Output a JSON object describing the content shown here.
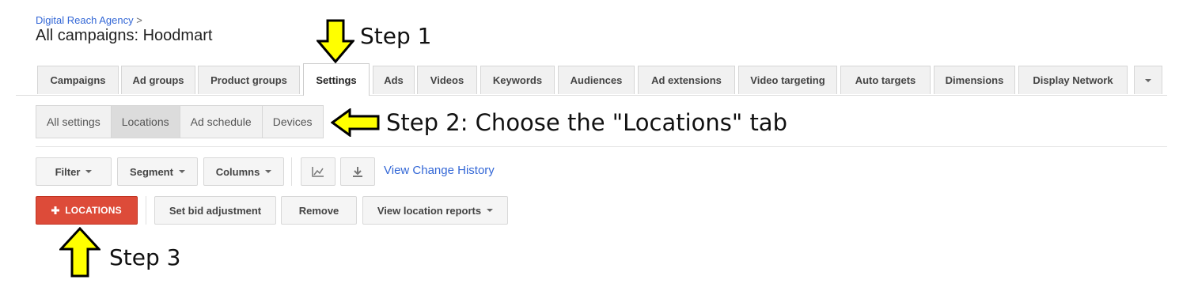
{
  "breadcrumb": {
    "parent": "Digital Reach Agency",
    "separator": ">"
  },
  "page_title": "All campaigns: Hoodmart",
  "main_tabs": [
    {
      "label": "Campaigns"
    },
    {
      "label": "Ad groups"
    },
    {
      "label": "Product groups"
    },
    {
      "label": "Settings"
    },
    {
      "label": "Ads"
    },
    {
      "label": "Videos"
    },
    {
      "label": "Keywords"
    },
    {
      "label": "Audiences"
    },
    {
      "label": "Ad extensions"
    },
    {
      "label": "Video targeting"
    },
    {
      "label": "Auto targets"
    },
    {
      "label": "Dimensions"
    },
    {
      "label": "Display Network"
    }
  ],
  "active_main_tab": "Settings",
  "sub_tabs": [
    {
      "label": "All settings"
    },
    {
      "label": "Locations"
    },
    {
      "label": "Ad schedule"
    },
    {
      "label": "Devices"
    }
  ],
  "active_sub_tab": "Locations",
  "toolbar": {
    "filter_label": "Filter",
    "segment_label": "Segment",
    "columns_label": "Columns",
    "chart_icon": "chart-line-icon",
    "download_icon": "download-icon",
    "change_history_link": "View Change History"
  },
  "actions": {
    "add_locations_label": "LOCATIONS",
    "add_icon": "plus-icon",
    "set_bid_label": "Set bid adjustment",
    "remove_label": "Remove",
    "view_reports_label": "View location reports"
  },
  "annotations": {
    "step1": "Step 1",
    "step2": "Step 2: Choose the \"Locations\" tab",
    "step3": "Step 3"
  },
  "colors": {
    "link": "#3367d6",
    "primary_button": "#dd4b39",
    "arrow_fill": "#ffff00"
  }
}
